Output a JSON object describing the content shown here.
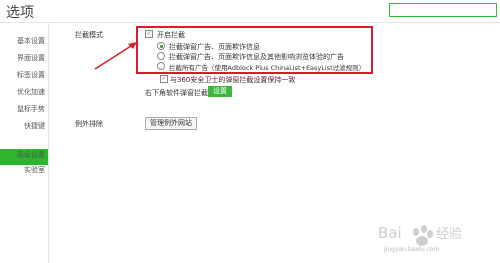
{
  "window": {
    "title": "选项",
    "search_value": ""
  },
  "sidebar": {
    "items": [
      {
        "label": "基本设置"
      },
      {
        "label": "界面设置"
      },
      {
        "label": "标签设置"
      },
      {
        "label": "优化加速"
      },
      {
        "label": "鼠标手势"
      },
      {
        "label": "快捷键"
      },
      {
        "label": "广告过滤"
      },
      {
        "label": "高级设置"
      },
      {
        "label": "实验室"
      }
    ],
    "active_index": 6,
    "active_color": "#2fb42f"
  },
  "main": {
    "block_mode_label": "拦截模式",
    "enable_block": "开启拦截",
    "options": [
      "拦截弹窗广告、页面欺诈信息",
      "拦截弹窗广告、页面欺诈信息及其他影响浏览体验的广告",
      "拦截所有广告（使用Adblock Plus ChinaList+EasyList过滤规则）"
    ],
    "selected_option": 0,
    "sync_360": "与360安全卫士的弹窗拦截设置保持一致",
    "bottom_right_label": "右下角软件弹窗拦截",
    "settings_button": "设置",
    "exclusion_label": "例外排除",
    "manage_button": "管理例外网站",
    "highlight_color": "#d81c2a"
  },
  "watermark": {
    "text": "jingyan.baidu.com",
    "icon": "baidu-paw-logo"
  }
}
